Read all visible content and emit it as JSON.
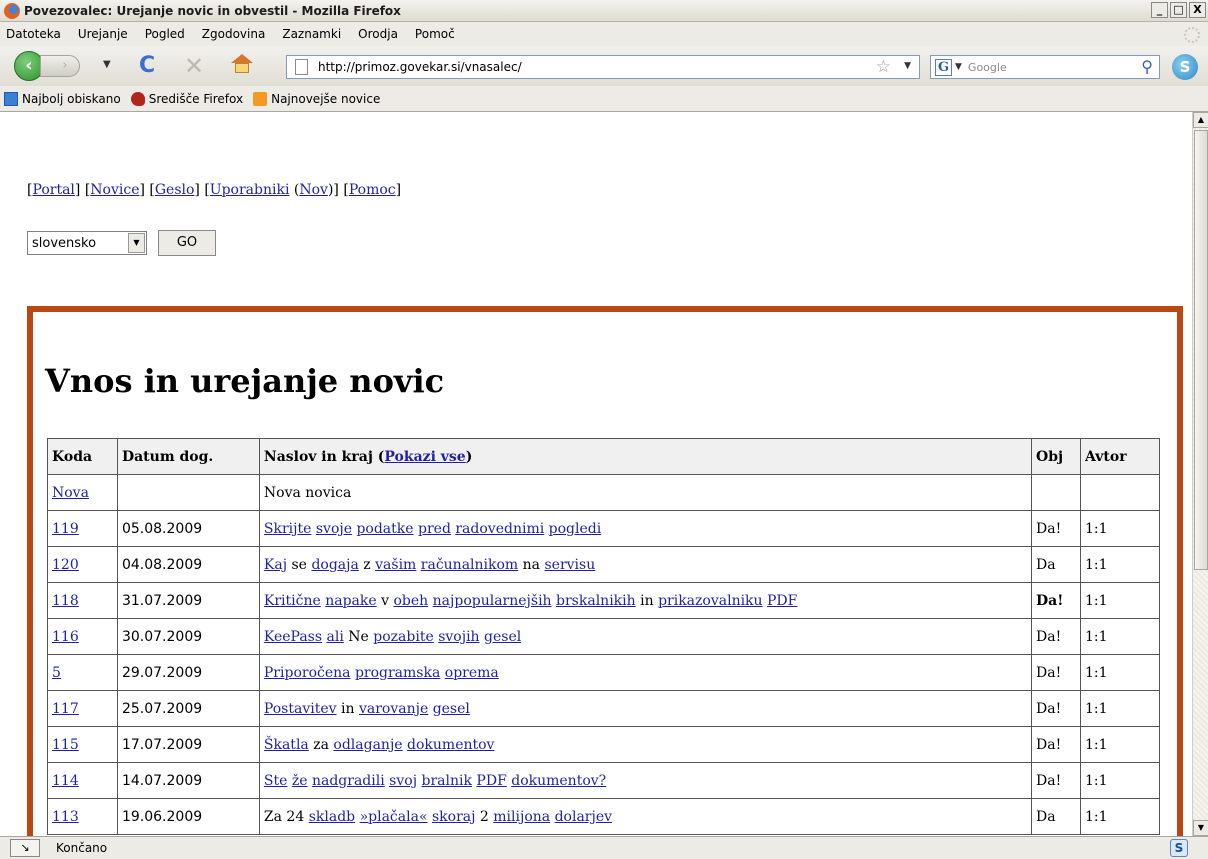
{
  "window": {
    "title": "Povezovalec: Urejanje novic in obvestil - Mozilla Firefox",
    "btn_min": "_",
    "btn_max": "□",
    "btn_close": "X"
  },
  "menu": [
    "Datoteka",
    "Urejanje",
    "Pogled",
    "Zgodovina",
    "Zaznamki",
    "Orodja",
    "Pomoč"
  ],
  "nav": {
    "url": "http://primoz.govekar.si/vnasalec/",
    "search_placeholder": "Google",
    "search_engine_letter": "G"
  },
  "bookmarks": [
    "Najbolj obiskano",
    "Središče Firefox",
    "Najnovejše novice"
  ],
  "page": {
    "links": [
      "Portal",
      "Novice",
      "Geslo",
      "Uporabniki",
      "Nov",
      "Pomoc"
    ],
    "language": "slovensko",
    "go_label": "GO",
    "heading": "Vnos in urejanje novic",
    "table": {
      "headers": {
        "koda": "Koda",
        "datum": "Datum dog.",
        "naslov_prefix": "Naslov in kraj (",
        "naslov_link": "Pokazi vse",
        "naslov_suffix": ")",
        "obj": "Obj",
        "avtor": "Avtor"
      },
      "new_row": {
        "koda": "Nova",
        "naslov": "Nova novica"
      },
      "rows": [
        {
          "koda": "119",
          "datum": "05.08.2009",
          "naslov": "Skrijte svoje podatke pred radovednimi pogledi",
          "obj": "Da!",
          "avtor": "1:1"
        },
        {
          "koda": "120",
          "datum": "04.08.2009",
          "naslov": "Kaj se dogaja z vašim računalnikom na servisu",
          "obj": "Da",
          "avtor": "1:1"
        },
        {
          "koda": "118",
          "datum": "31.07.2009",
          "naslov": "Kritične napake v obeh najpopularnejših brskalnikih in prikazovalniku PDF",
          "obj": "Da!",
          "avtor": "1:1",
          "obj_bold": true
        },
        {
          "koda": "116",
          "datum": "30.07.2009",
          "naslov": "KeePass ali Ne pozabite svojih gesel",
          "obj": "Da!",
          "avtor": "1:1"
        },
        {
          "koda": "5",
          "datum": "29.07.2009",
          "naslov": "Priporočena programska oprema",
          "obj": "Da!",
          "avtor": "1:1"
        },
        {
          "koda": "117",
          "datum": "25.07.2009",
          "naslov": "Postavitev in varovanje gesel",
          "obj": "Da!",
          "avtor": "1:1"
        },
        {
          "koda": "115",
          "datum": "17.07.2009",
          "naslov": "Škatla za odlaganje dokumentov",
          "obj": "Da!",
          "avtor": "1:1"
        },
        {
          "koda": "114",
          "datum": "14.07.2009",
          "naslov": "Ste že nadgradili svoj bralnik PDF dokumentov?",
          "obj": "Da!",
          "avtor": "1:1"
        },
        {
          "koda": "113",
          "datum": "19.06.2009",
          "naslov": "Za 24 skladb »plačala« skoraj 2 milijona dolarjev",
          "obj": "Da",
          "avtor": "1:1"
        }
      ]
    }
  },
  "status": {
    "text": "Končano",
    "addon_letter": "S"
  },
  "colors": {
    "panel_border": "#bb4714",
    "link": "#1f1fa8"
  }
}
